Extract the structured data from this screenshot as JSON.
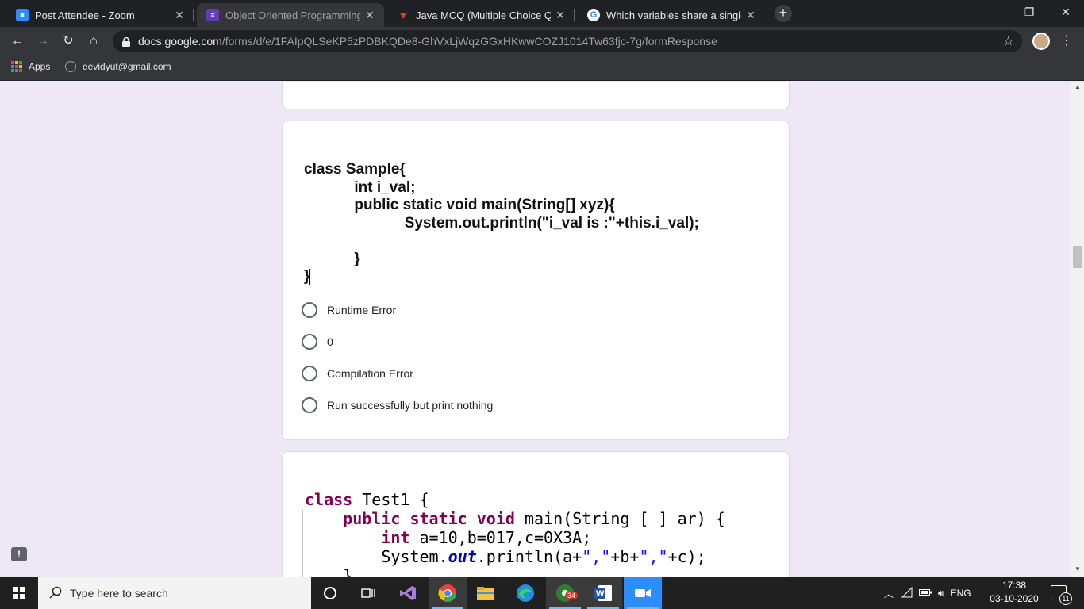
{
  "browser": {
    "tabs": [
      {
        "title": "Post Attendee - Zoom",
        "favicon_color": "#2d8cff"
      },
      {
        "title": "Object Oriented Programming w",
        "favicon_color": "#673ab7"
      },
      {
        "title": "Java MCQ (Multiple Choice Ques",
        "favicon_color": "#e53935"
      },
      {
        "title": "Which variables share a single co",
        "favicon_color": "#ffffff"
      }
    ],
    "new_tab_label": "+",
    "url_host": "docs.google.com",
    "url_path": "/forms/d/e/1FAIpQLSeKP5zPDBKQDe8-GhVxLjWqzGGxHKwwCOZJ1014Tw63fjc-7g/formResponse",
    "bookmarks": [
      {
        "label": "Apps",
        "icon": "apps-grid-icon"
      },
      {
        "label": "eevidyut@gmail.com",
        "icon": "globe-icon"
      }
    ]
  },
  "question1": {
    "code_lines": [
      "class Sample{",
      "            int i_val;",
      "            public static void main(String[] xyz){",
      "                        System.out.println(\"i_val is :\"+this.i_val);",
      "",
      "            }",
      "}"
    ],
    "options": [
      "Runtime Error",
      "0",
      "Compilation Error",
      "Run successfully but print nothing"
    ]
  },
  "question2": {
    "code_lines": [
      "class Test1 {",
      "    public static void main(String [ ] ar) {",
      "        int a=10,b=017,c=0X3A;",
      "        System.out.println(a+\",\"+b+\",\"+c);",
      "    }"
    ]
  },
  "taskbar": {
    "search_placeholder": "Type here to search",
    "chrome_badge": "34",
    "language": "ENG",
    "time": "17:38",
    "date": "03-10-2020",
    "notification_count": "11"
  },
  "colors": {
    "page_bg": "#ede7f6",
    "chrome_dark": "#202124",
    "toolbar": "#35363a"
  }
}
